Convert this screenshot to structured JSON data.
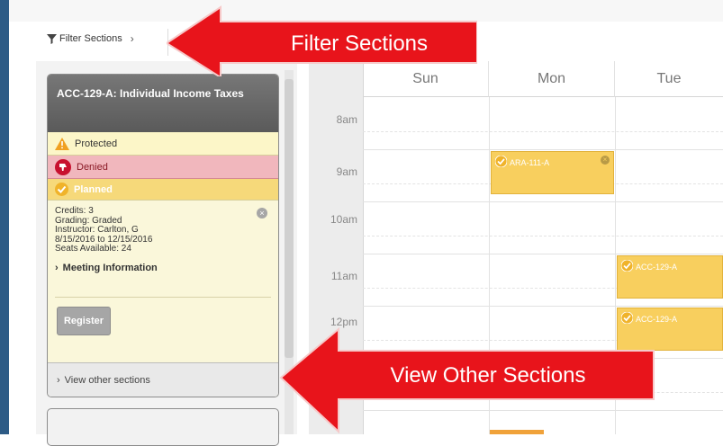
{
  "toolbar": {
    "filter_label": "Filter Sections"
  },
  "course_card": {
    "title": "ACC-129-A: Individual Income Taxes",
    "statuses": {
      "protected": "Protected",
      "denied": "Denied",
      "planned": "Planned"
    },
    "credits": "Credits: 3",
    "grading": "Grading: Graded",
    "instructor": "Instructor: Carlton, G",
    "dates": "8/15/2016 to 12/15/2016",
    "seats": "Seats Available:  24",
    "meeting_info": "Meeting Information",
    "register": "Register",
    "view_other": "View other sections"
  },
  "calendar": {
    "days": [
      "Sun",
      "Mon",
      "Tue"
    ],
    "times": [
      "8am",
      "9am",
      "10am",
      "11am",
      "12pm"
    ],
    "events": [
      {
        "label": "ARA-111-A",
        "day": "Mon",
        "start": "9am"
      },
      {
        "label": "ACC-129-A",
        "day": "Tue",
        "start": "11am"
      },
      {
        "label": "ACC-129-A",
        "day": "Tue",
        "start": "12pm"
      }
    ]
  },
  "callouts": {
    "filter": "Filter Sections",
    "view_other": "View Other Sections"
  },
  "colors": {
    "accent_blue": "#2d5b86",
    "callout_red": "#e8141b",
    "event_yellow": "#f8cf5e",
    "denied_pink": "#f1b7bd"
  }
}
